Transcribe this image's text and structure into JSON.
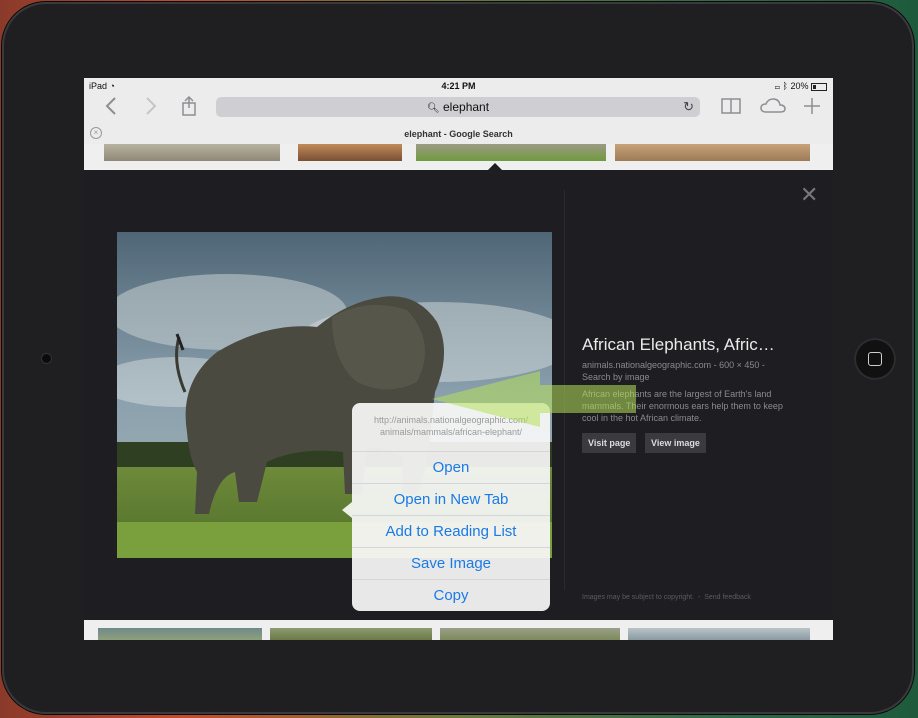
{
  "status": {
    "device": "iPad",
    "time": "4:21 PM",
    "battery": "20%"
  },
  "toolbar": {
    "back_icon": "chevron-left-icon",
    "forward_icon": "chevron-right-icon",
    "share_icon": "share-icon",
    "search_query": "elephant",
    "bookmarks_icon": "book-icon",
    "icloud_icon": "cloud-icon",
    "new_tab_icon": "plus-icon"
  },
  "tab": {
    "title": "elephant - Google Search"
  },
  "context_menu": {
    "url_line1": "http://animals.nationalgeographic.com/",
    "url_line2": "animals/mammals/african-elephant/",
    "items": [
      "Open",
      "Open in New Tab",
      "Add to Reading List",
      "Save Image",
      "Copy"
    ]
  },
  "image_info": {
    "title": "African Elephants, Afric…",
    "source": "animals.nationalgeographic.com - 600 × 450 -",
    "search_by_image": "Search by image",
    "description": "African elephants are the largest of Earth's land mammals. Their enormous ears help them to keep cool in the hot African climate.",
    "visit_page": "Visit page",
    "view_image": "View image",
    "copyright_note": "Images may be subject to copyright.",
    "send_feedback": "Send feedback"
  },
  "colors": {
    "link_blue": "#1a7ae8",
    "highlight_arrow": "#b4e05a"
  }
}
